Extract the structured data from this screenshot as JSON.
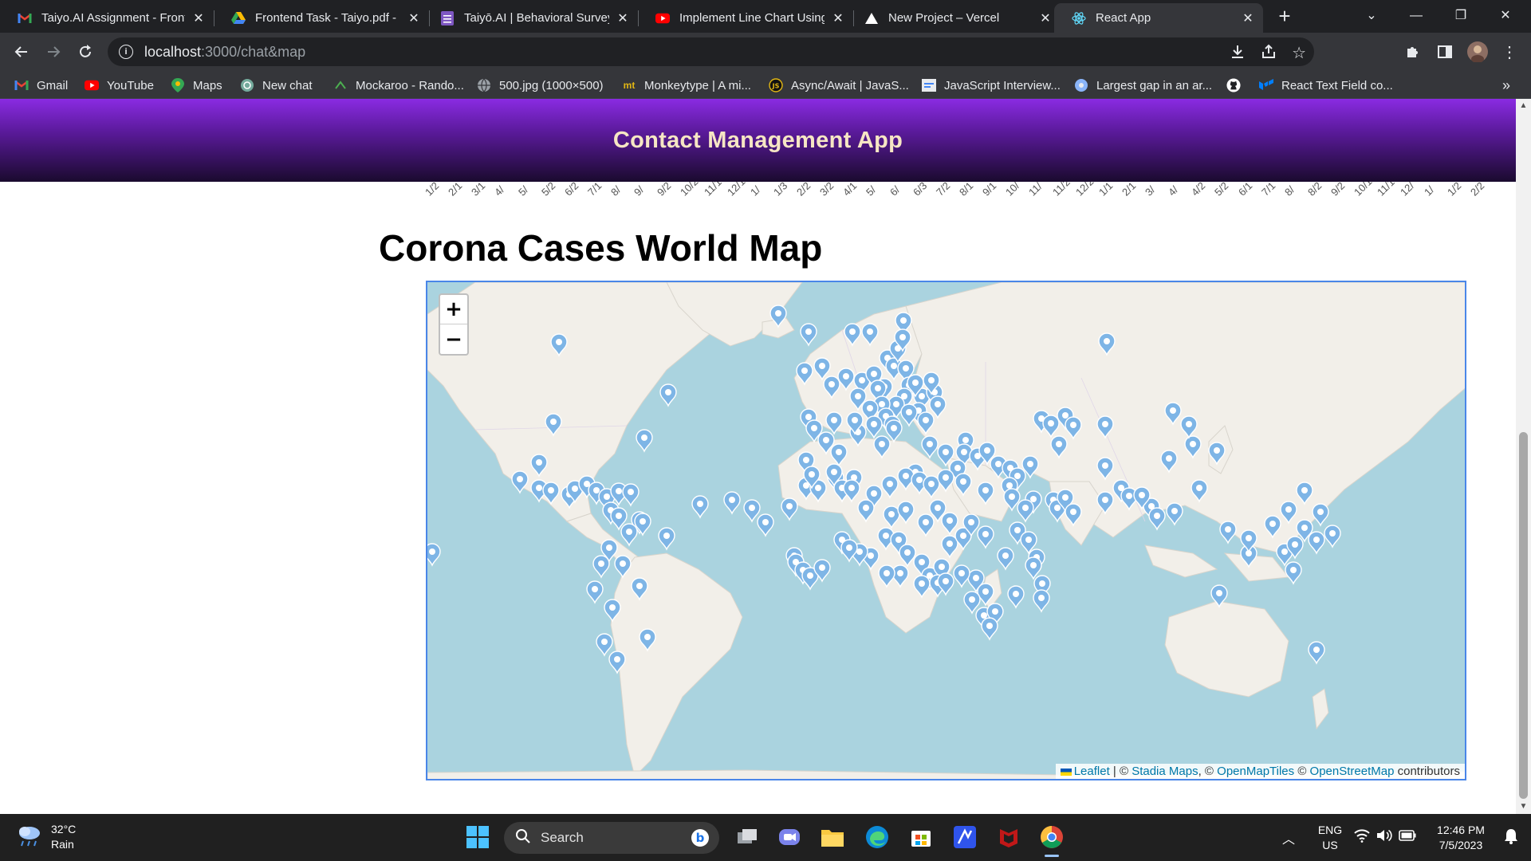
{
  "browser": {
    "tabs": [
      {
        "title": "Taiyo.AI Assignment - Front",
        "icon": "gmail-icon",
        "active": false
      },
      {
        "title": "Frontend Task - Taiyo.pdf - ",
        "icon": "google-drive-icon",
        "active": false
      },
      {
        "title": "Taiyō.AI | Behavioral Survey",
        "icon": "forms-icon",
        "active": false
      },
      {
        "title": "Implement Line Chart Using",
        "icon": "youtube-icon",
        "active": false
      },
      {
        "title": "New Project – Vercel",
        "icon": "vercel-icon",
        "active": false
      },
      {
        "title": "React App",
        "icon": "react-icon",
        "active": true
      }
    ],
    "url_host": "localhost",
    "url_path": ":3000/chat&map",
    "bookmarks": [
      {
        "label": "Gmail",
        "icon": "gmail-icon"
      },
      {
        "label": "YouTube",
        "icon": "youtube-icon"
      },
      {
        "label": "Maps",
        "icon": "maps-icon"
      },
      {
        "label": "New chat",
        "icon": "chatgpt-icon"
      },
      {
        "label": "Mockaroo - Rando...",
        "icon": "mockaroo-icon"
      },
      {
        "label": "500.jpg (1000×500)",
        "icon": "globe-icon"
      },
      {
        "label": "Monkeytype | A mi...",
        "icon": "monkeytype-icon"
      },
      {
        "label": "Async/Await | JavaS...",
        "icon": "js-icon"
      },
      {
        "label": "JavaScript Interview...",
        "icon": "doc-icon"
      },
      {
        "label": "Largest gap in an ar...",
        "icon": "globe-icon"
      },
      {
        "label": "",
        "icon": "github-icon"
      },
      {
        "label": "React Text Field co...",
        "icon": "mui-icon"
      }
    ],
    "more_bookmarks": "»"
  },
  "page": {
    "app_title": "Contact Management App",
    "chart_tick_labels": [
      "1/2",
      "2/1",
      "3/1",
      "4/",
      "5/",
      "5/2",
      "6/2",
      "7/1",
      "8/",
      "9/",
      "9/2",
      "10/2",
      "11/1",
      "12/1",
      "1/",
      "1/3",
      "2/2",
      "3/2",
      "4/1",
      "5/",
      "6/",
      "6/3",
      "7/2",
      "8/1",
      "9/1",
      "10/",
      "11/",
      "11/2",
      "12/2",
      "1/1",
      "2/1",
      "3/",
      "4/",
      "4/2",
      "5/2",
      "6/1",
      "7/1",
      "8/",
      "8/2",
      "9/2",
      "10/1",
      "11/1",
      "12/",
      "1/",
      "1/2",
      "2/2"
    ],
    "heading": "Corona Cases World Map",
    "map": {
      "zoom_in": "+",
      "zoom_out": "−",
      "attribution": {
        "leaflet": "Leaflet",
        "sep1": " | © ",
        "stadia": "Stadia Maps",
        "sep2": ", © ",
        "omt": "OpenMapTiles",
        "sep3": " © ",
        "osm": "OpenStreetMap",
        "tail": " contributors"
      },
      "marker_color": "#7eb5e6",
      "water_color": "#aad3df",
      "land_color": "#f2efe9"
    }
  },
  "taskbar": {
    "weather_temp": "32°C",
    "weather_desc": "Rain",
    "search_label": "Search",
    "lang_top": "ENG",
    "lang_bottom": "US",
    "time": "12:46 PM",
    "date": "7/5/2023"
  }
}
